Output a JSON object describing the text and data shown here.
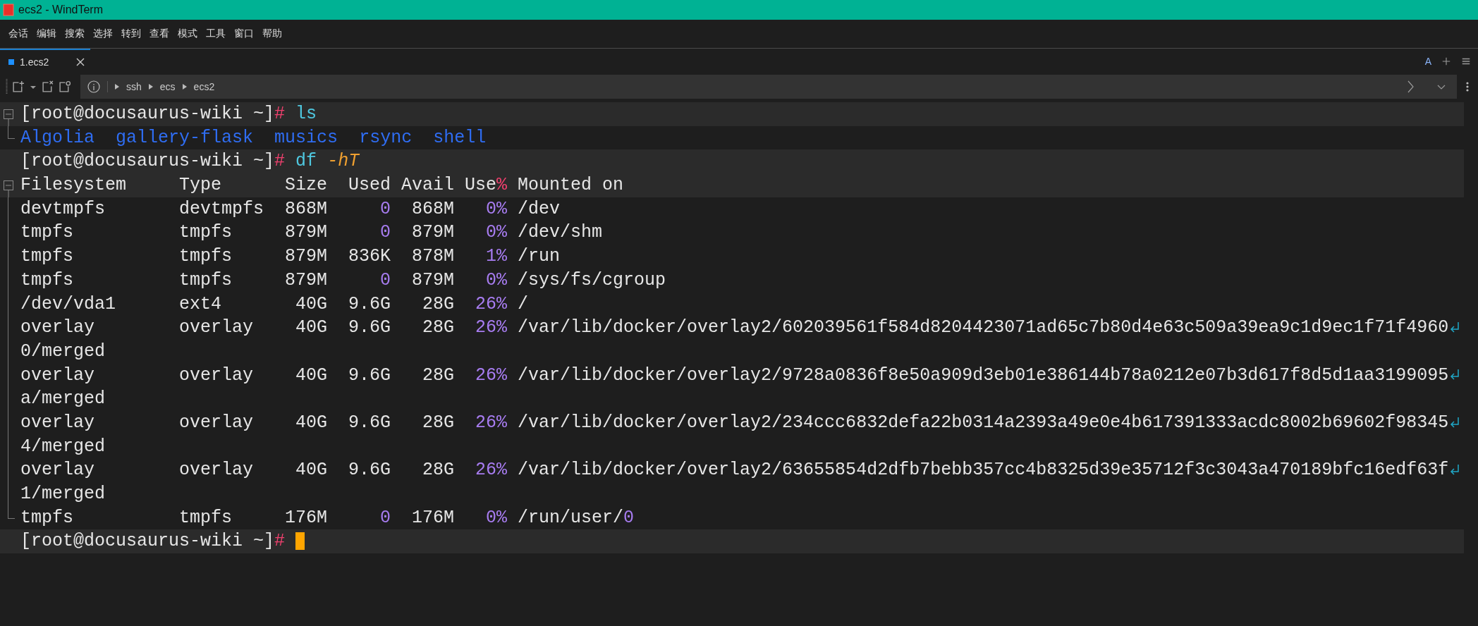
{
  "window": {
    "title": "ecs2 - WindTerm"
  },
  "menu": [
    "会话",
    "编辑",
    "搜索",
    "选择",
    "转到",
    "查看",
    "模式",
    "工具",
    "窗口",
    "帮助"
  ],
  "tabs": [
    {
      "label": "1.ecs2",
      "selected": true
    }
  ],
  "font_button": "A",
  "breadcrumbs": [
    "ssh",
    "ecs",
    "ecs2"
  ],
  "terminal": [
    {
      "kind": "prompt",
      "gutter": {
        "kind": "collapse"
      },
      "highlighted": true,
      "prompt": "[root@docusaurus-wiki ~]",
      "symbol": "#",
      "command": "ls"
    },
    {
      "kind": "listing",
      "gutter": {
        "kind": "end"
      },
      "highlighted": false,
      "items": [
        "Algolia",
        "gallery-flask",
        "musics",
        "rsync",
        "shell"
      ]
    },
    {
      "kind": "prompt",
      "highlighted": true,
      "prompt": "[root@docusaurus-wiki ~]",
      "symbol": "#",
      "command": "df",
      "args": "-hT"
    },
    {
      "kind": "df_header",
      "gutter": {
        "kind": "collapse"
      },
      "highlighted": true,
      "cells": [
        {
          "text": "Filesystem"
        },
        {
          "text": "Type"
        },
        {
          "text": "Size"
        },
        {
          "text": "Used"
        },
        {
          "text": "Avail"
        },
        {
          "text": "Use",
          "mark": "%"
        },
        {
          "text": "Mounted on"
        }
      ]
    },
    {
      "kind": "df_row",
      "gutter": {
        "kind": "line"
      },
      "highlighted": false,
      "filesystem": "devtmpfs",
      "type": "devtmpfs",
      "size": "868M",
      "used": "0",
      "avail": "868M",
      "use": "0%",
      "mounted_on": "/dev"
    },
    {
      "kind": "df_row",
      "gutter": {
        "kind": "line"
      },
      "highlighted": false,
      "filesystem": "tmpfs",
      "type": "tmpfs",
      "size": "879M",
      "used": "0",
      "avail": "879M",
      "use": "0%",
      "mounted_on": "/dev/shm"
    },
    {
      "kind": "df_row",
      "gutter": {
        "kind": "line"
      },
      "highlighted": false,
      "filesystem": "tmpfs",
      "type": "tmpfs",
      "size": "879M",
      "used": "836K",
      "avail": "878M",
      "use": "1%",
      "mounted_on": "/run"
    },
    {
      "kind": "df_row",
      "gutter": {
        "kind": "line"
      },
      "highlighted": false,
      "filesystem": "tmpfs",
      "type": "tmpfs",
      "size": "879M",
      "used": "0",
      "avail": "879M",
      "use": "0%",
      "mounted_on": "/sys/fs/cgroup"
    },
    {
      "kind": "df_row",
      "gutter": {
        "kind": "line"
      },
      "highlighted": false,
      "filesystem": "/dev/vda1",
      "type": "ext4",
      "size": "40G",
      "used": "9.6G",
      "avail": "28G",
      "use": "26%",
      "mounted_on": "/"
    },
    {
      "kind": "df_row",
      "gutter": {
        "kind": "line"
      },
      "highlighted": false,
      "filesystem": "overlay",
      "type": "overlay",
      "size": "40G",
      "used": "9.6G",
      "avail": "28G",
      "use": "26%",
      "mounted_on": "/var/lib/docker/overlay2/602039561f584d8204423071ad65c7b80d4e63c509a39ea9c1d9ec1f71f4960",
      "continuation": "0/merged"
    },
    {
      "kind": "df_row",
      "gutter": {
        "kind": "line"
      },
      "highlighted": false,
      "filesystem": "overlay",
      "type": "overlay",
      "size": "40G",
      "used": "9.6G",
      "avail": "28G",
      "use": "26%",
      "mounted_on": "/var/lib/docker/overlay2/9728a0836f8e50a909d3eb01e386144b78a0212e07b3d617f8d5d1aa3199095",
      "continuation": "a/merged"
    },
    {
      "kind": "df_row",
      "gutter": {
        "kind": "line"
      },
      "highlighted": false,
      "filesystem": "overlay",
      "type": "overlay",
      "size": "40G",
      "used": "9.6G",
      "avail": "28G",
      "use": "26%",
      "mounted_on": "/var/lib/docker/overlay2/234ccc6832defa22b0314a2393a49e0e4b617391333acdc8002b69602f98345",
      "continuation": "4/merged"
    },
    {
      "kind": "df_row",
      "gutter": {
        "kind": "line"
      },
      "highlighted": false,
      "filesystem": "overlay",
      "type": "overlay",
      "size": "40G",
      "used": "9.6G",
      "avail": "28G",
      "use": "26%",
      "mounted_on": "/var/lib/docker/overlay2/63655854d2dfb7bebb357cc4b8325d39e35712f3c3043a470189bfc16edf63f",
      "continuation": "1/merged"
    },
    {
      "kind": "df_row",
      "gutter": {
        "kind": "end"
      },
      "highlighted": false,
      "filesystem": "tmpfs",
      "type": "tmpfs",
      "size": "176M",
      "used": "0",
      "avail": "176M",
      "use": "0%",
      "mounted_on": "/run/user/",
      "mounted_on_number": "0"
    },
    {
      "kind": "prompt",
      "highlighted": true,
      "prompt": "[root@docusaurus-wiki ~]",
      "symbol": "#",
      "cursor": true
    }
  ]
}
